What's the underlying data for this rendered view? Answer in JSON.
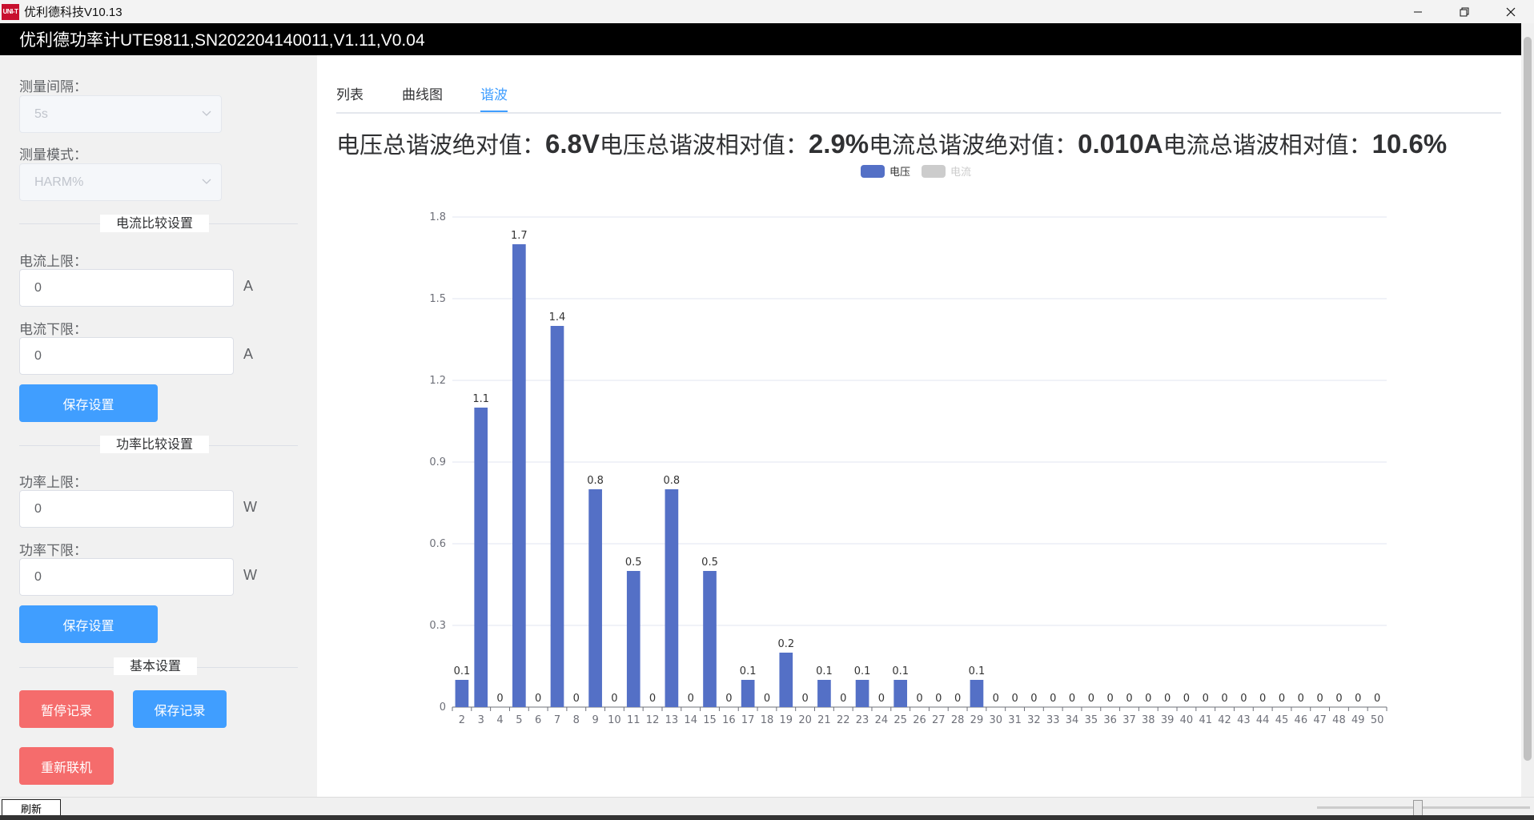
{
  "window": {
    "logo_text": "UNI-T",
    "title": "优利德科技V10.13",
    "minimize_icon": "minimize-icon",
    "restore_icon": "restore-icon",
    "close_icon": "close-icon"
  },
  "device": {
    "header": "优利德功率计UTE9811,SN202204140011,V1.11,V0.04"
  },
  "sidebar": {
    "interval_label": "测量间隔：",
    "interval_value": "5s",
    "mode_label": "测量模式：",
    "mode_value": "HARM%",
    "current_section": "电流比较设置",
    "current_upper_label": "电流上限：",
    "current_upper_value": "0",
    "current_upper_unit": "A",
    "current_lower_label": "电流下限：",
    "current_lower_value": "0",
    "current_lower_unit": "A",
    "save_current_button": "保存设置",
    "power_section": "功率比较设置",
    "power_upper_label": "功率上限：",
    "power_upper_value": "0",
    "power_upper_unit": "W",
    "power_lower_label": "功率下限：",
    "power_lower_value": "0",
    "power_lower_unit": "W",
    "save_power_button": "保存设置",
    "basic_section": "基本设置",
    "pause_button": "暂停记录",
    "save_record_button": "保存记录",
    "reconnect_button": "重新联机"
  },
  "tabs": [
    {
      "label": "列表",
      "active": false
    },
    {
      "label": "曲线图",
      "active": false
    },
    {
      "label": "谐波",
      "active": true
    }
  ],
  "summary": {
    "v_abs_label": "电压总谐波绝对值：",
    "v_abs_value": "6.8V",
    "v_rel_label": "电压总谐波相对值：",
    "v_rel_value": "2.9%",
    "i_abs_label": "电流总谐波绝对值：",
    "i_abs_value": "0.010A",
    "i_rel_label": "电流总谐波相对值：",
    "i_rel_value": "10.6%"
  },
  "legend": {
    "voltage": "电压",
    "current": "电流",
    "voltage_color": "#5470c6",
    "current_color": "#cccccc"
  },
  "chart_data": {
    "type": "bar",
    "categories": [
      "2",
      "3",
      "4",
      "5",
      "6",
      "7",
      "8",
      "9",
      "10",
      "11",
      "12",
      "13",
      "14",
      "15",
      "16",
      "17",
      "18",
      "19",
      "20",
      "21",
      "22",
      "23",
      "24",
      "25",
      "26",
      "27",
      "28",
      "29",
      "30",
      "31",
      "32",
      "33",
      "34",
      "35",
      "36",
      "37",
      "38",
      "39",
      "40",
      "41",
      "42",
      "43",
      "44",
      "45",
      "46",
      "47",
      "48",
      "49",
      "50"
    ],
    "series": [
      {
        "name": "电压",
        "values": [
          0.1,
          1.1,
          0,
          1.7,
          0,
          1.4,
          0,
          0.8,
          0,
          0.5,
          0,
          0.8,
          0,
          0.5,
          0,
          0.1,
          0,
          0.2,
          0,
          0.1,
          0,
          0.1,
          0,
          0.1,
          0,
          0,
          0,
          0.1,
          0,
          0,
          0,
          0,
          0,
          0,
          0,
          0,
          0,
          0,
          0,
          0,
          0,
          0,
          0,
          0,
          0,
          0,
          0,
          0,
          0
        ]
      }
    ],
    "yticks": [
      "0",
      "0.3",
      "0.6",
      "0.9",
      "1.2",
      "1.5",
      "1.8"
    ],
    "ylim": [
      0,
      1.8
    ],
    "grid": true,
    "legend_position": "top-center"
  },
  "footer": {
    "refresh_button": "刷新"
  }
}
